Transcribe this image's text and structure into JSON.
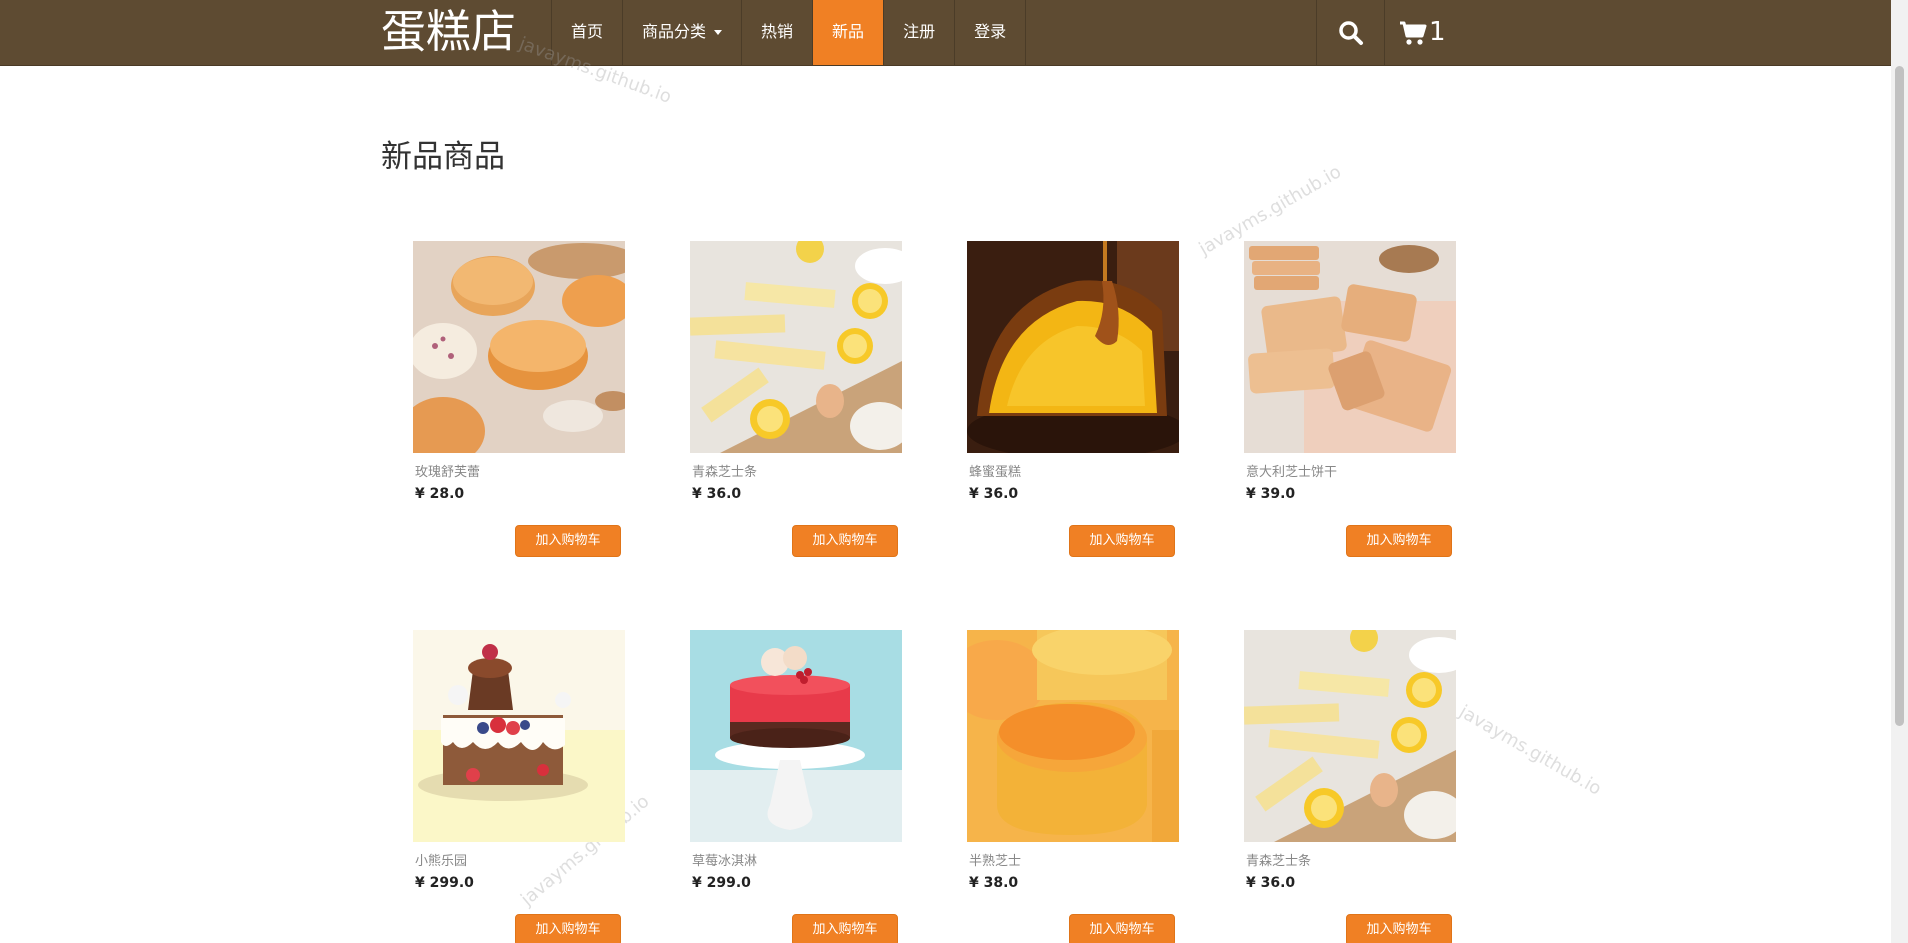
{
  "brand": "蛋糕店",
  "nav": {
    "items": [
      {
        "label": "首页",
        "active": false
      },
      {
        "label": "商品分类",
        "active": false,
        "dropdown": true
      },
      {
        "label": "热销",
        "active": false
      },
      {
        "label": "新品",
        "active": true
      },
      {
        "label": "注册",
        "active": false
      },
      {
        "label": "登录",
        "active": false
      }
    ],
    "search_icon": "search-icon",
    "cart_icon": "cart-icon",
    "cart_count": "1"
  },
  "page_title": "新品商品",
  "add_to_cart_label": "加入购物车",
  "products": [
    {
      "name": "玫瑰舒芙蕾",
      "price": "¥ 28.0"
    },
    {
      "name": "青森芝士条",
      "price": "¥ 36.0"
    },
    {
      "name": "蜂蜜蛋糕",
      "price": "¥ 36.0"
    },
    {
      "name": "意大利芝士饼干",
      "price": "¥ 39.0"
    },
    {
      "name": "小熊乐园",
      "price": "¥ 299.0"
    },
    {
      "name": "草莓冰淇淋",
      "price": "¥ 299.0"
    },
    {
      "name": "半熟芝士",
      "price": "¥ 38.0"
    },
    {
      "name": "青森芝士条",
      "price": "¥ 36.0"
    }
  ],
  "watermark": "javayms.github.io",
  "colors": {
    "navbar": "#5e4b32",
    "accent": "#f08024"
  }
}
